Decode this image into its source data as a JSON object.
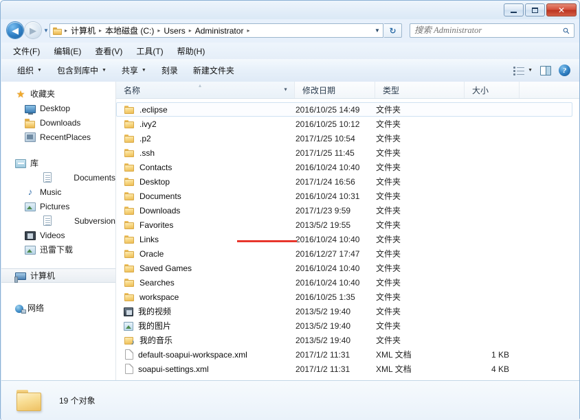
{
  "window": {
    "controls": {
      "minimize": "–",
      "maximize": "□",
      "close": "✕"
    }
  },
  "address_bar": {
    "back_arrow": "◀",
    "forward_arrow": "▶",
    "history_caret": "▼",
    "breadcrumb": [
      "计算机",
      "本地磁盘 (C:)",
      "Users",
      "Administrator"
    ],
    "separator": "▸",
    "dropdown_caret": "▼",
    "refresh_label": "↻"
  },
  "search": {
    "placeholder": "搜索 Administrator",
    "value": "",
    "icon": "⚲"
  },
  "menubar": {
    "items": [
      {
        "label": "文件(F)"
      },
      {
        "label": "编辑(E)"
      },
      {
        "label": "查看(V)"
      },
      {
        "label": "工具(T)"
      },
      {
        "label": "帮助(H)"
      }
    ]
  },
  "toolbar": {
    "items": [
      {
        "label": "组织",
        "caret": "▼"
      },
      {
        "label": "包含到库中",
        "caret": "▼"
      },
      {
        "label": "共享",
        "caret": "▼"
      },
      {
        "label": "刻录",
        "caret": ""
      },
      {
        "label": "新建文件夹",
        "caret": ""
      }
    ],
    "views_caret": "▼",
    "help_glyph": "?"
  },
  "sidebar": {
    "groups": [
      {
        "root": {
          "label": "收藏夹",
          "icon": "star-icon"
        },
        "children": [
          {
            "label": "Desktop",
            "icon": "monitor-icon"
          },
          {
            "label": "Downloads",
            "icon": "folder-icon"
          },
          {
            "label": "RecentPlaces",
            "icon": "recent-places-icon"
          }
        ]
      },
      {
        "root": {
          "label": "库",
          "icon": "library-icon"
        },
        "children": [
          {
            "label": "Documents",
            "icon": "document-icon"
          },
          {
            "label": "Music",
            "icon": "music-note-icon"
          },
          {
            "label": "Pictures",
            "icon": "picture-icon"
          },
          {
            "label": "Subversion",
            "icon": "document-icon"
          },
          {
            "label": "Videos",
            "icon": "video-icon"
          },
          {
            "label": "迅雷下载",
            "icon": "picture-icon"
          }
        ]
      }
    ],
    "computer": {
      "label": "计算机",
      "icon": "computer-icon",
      "selected": true
    },
    "network": {
      "label": "网络",
      "icon": "network-icon"
    }
  },
  "columns": {
    "name": "名称",
    "date": "修改日期",
    "type": "类型",
    "size": "大小",
    "sort_caret": "▼",
    "sort_indicator": "▴"
  },
  "files": [
    {
      "name": ".eclipse",
      "date": "2016/10/25 14:49",
      "type": "文件夹",
      "size": "",
      "icon": "folder-icon",
      "focused": true
    },
    {
      "name": ".ivy2",
      "date": "2016/10/25 10:12",
      "type": "文件夹",
      "size": "",
      "icon": "folder-icon",
      "focused": false
    },
    {
      "name": ".p2",
      "date": "2017/1/25 10:54",
      "type": "文件夹",
      "size": "",
      "icon": "folder-icon",
      "focused": false
    },
    {
      "name": ".ssh",
      "date": "2017/1/25 11:45",
      "type": "文件夹",
      "size": "",
      "icon": "folder-icon",
      "focused": false
    },
    {
      "name": "Contacts",
      "date": "2016/10/24 10:40",
      "type": "文件夹",
      "size": "",
      "icon": "folder-icon",
      "focused": false
    },
    {
      "name": "Desktop",
      "date": "2017/1/24 16:56",
      "type": "文件夹",
      "size": "",
      "icon": "folder-icon",
      "focused": false
    },
    {
      "name": "Documents",
      "date": "2016/10/24 10:31",
      "type": "文件夹",
      "size": "",
      "icon": "folder-icon",
      "focused": false
    },
    {
      "name": "Downloads",
      "date": "2017/1/23 9:59",
      "type": "文件夹",
      "size": "",
      "icon": "folder-icon",
      "focused": false
    },
    {
      "name": "Favorites",
      "date": "2013/5/2 19:55",
      "type": "文件夹",
      "size": "",
      "icon": "folder-icon",
      "focused": false
    },
    {
      "name": "Links",
      "date": "2016/10/24 10:40",
      "type": "文件夹",
      "size": "",
      "icon": "folder-icon",
      "focused": false
    },
    {
      "name": "Oracle",
      "date": "2016/12/27 17:47",
      "type": "文件夹",
      "size": "",
      "icon": "folder-icon",
      "focused": false
    },
    {
      "name": "Saved Games",
      "date": "2016/10/24 10:40",
      "type": "文件夹",
      "size": "",
      "icon": "folder-icon",
      "focused": false
    },
    {
      "name": "Searches",
      "date": "2016/10/24 10:40",
      "type": "文件夹",
      "size": "",
      "icon": "folder-icon",
      "focused": false
    },
    {
      "name": "workspace",
      "date": "2016/10/25 1:35",
      "type": "文件夹",
      "size": "",
      "icon": "folder-icon",
      "focused": false
    },
    {
      "name": "我的视频",
      "date": "2013/5/2 19:40",
      "type": "文件夹",
      "size": "",
      "icon": "my-video-icon",
      "focused": false
    },
    {
      "name": "我的图片",
      "date": "2013/5/2 19:40",
      "type": "文件夹",
      "size": "",
      "icon": "my-picture-icon",
      "focused": false
    },
    {
      "name": "我的音乐",
      "date": "2013/5/2 19:40",
      "type": "文件夹",
      "size": "",
      "icon": "my-music-icon",
      "focused": false
    },
    {
      "name": "default-soapui-workspace.xml",
      "date": "2017/1/2 11:31",
      "type": "XML 文档",
      "size": "1 KB",
      "icon": "xml-file-icon",
      "focused": false
    },
    {
      "name": "soapui-settings.xml",
      "date": "2017/1/2 11:31",
      "type": "XML 文档",
      "size": "4 KB",
      "icon": "xml-file-icon",
      "focused": false
    }
  ],
  "annotation": {
    "color": "#e8362c",
    "target": ".ssh"
  },
  "statusbar": {
    "text": "19 个对象"
  }
}
